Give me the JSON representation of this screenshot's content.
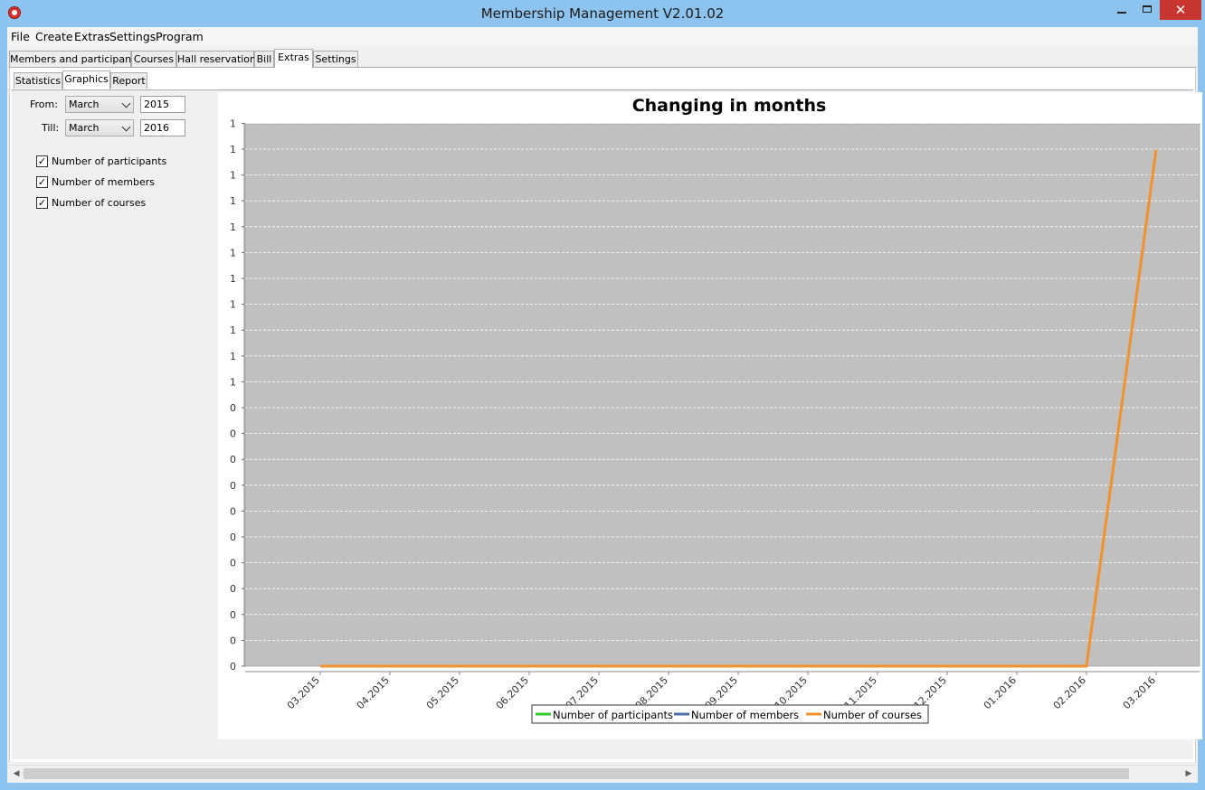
{
  "window": {
    "title": "Membership Management V2.01.02",
    "close_glyph": "✕"
  },
  "menu": [
    "File",
    "Create",
    "Extras",
    "Settings",
    "Program"
  ],
  "tabs": [
    "Members and participants",
    "Courses",
    "Hall reservation",
    "Bill",
    "Extras",
    "Settings"
  ],
  "active_tab": "Extras",
  "subtabs": [
    "Statistics",
    "Graphics",
    "Report"
  ],
  "active_subtab": "Graphics",
  "filters": {
    "from_label": "From:",
    "from_month": "March",
    "from_year": "2015",
    "till_label": "Till:",
    "till_month": "March",
    "till_year": "2016"
  },
  "checkboxes": [
    {
      "label": "Number of participants",
      "checked": true
    },
    {
      "label": "Number of members",
      "checked": true
    },
    {
      "label": "Number of courses",
      "checked": true
    }
  ],
  "check_glyph": "✓",
  "colors": {
    "participants": "#33cc33",
    "members": "#4f6fa8",
    "courses": "#f0922e",
    "plot_bg": "#c0c0c0",
    "close_btn": "#c7372f"
  },
  "chart_data": {
    "type": "line",
    "title": "Changing in months",
    "xlabel": "",
    "ylabel": "",
    "categories": [
      "03.2015",
      "04.2015",
      "05.2015",
      "06.2015",
      "07.2015",
      "08.2015",
      "09.2015",
      "10.2015",
      "11.2015",
      "12.2015",
      "01.2016",
      "02.2016",
      "03.2016"
    ],
    "y_tick_labels": [
      "1",
      "1",
      "1",
      "1",
      "1",
      "1",
      "1",
      "1",
      "1",
      "1",
      "1",
      "0",
      "0",
      "0",
      "0",
      "0",
      "0",
      "0",
      "0",
      "0",
      "0",
      "0"
    ],
    "ylim": [
      0,
      1.05
    ],
    "grid": true,
    "legend": "bottom",
    "series": [
      {
        "name": "Number of participants",
        "values": [
          0,
          0,
          0,
          0,
          0,
          0,
          0,
          0,
          0,
          0,
          0,
          0,
          1
        ]
      },
      {
        "name": "Number of members",
        "values": [
          0,
          0,
          0,
          0,
          0,
          0,
          0,
          0,
          0,
          0,
          0,
          0,
          1
        ]
      },
      {
        "name": "Number of courses",
        "values": [
          0,
          0,
          0,
          0,
          0,
          0,
          0,
          0,
          0,
          0,
          0,
          0,
          1
        ]
      }
    ]
  }
}
